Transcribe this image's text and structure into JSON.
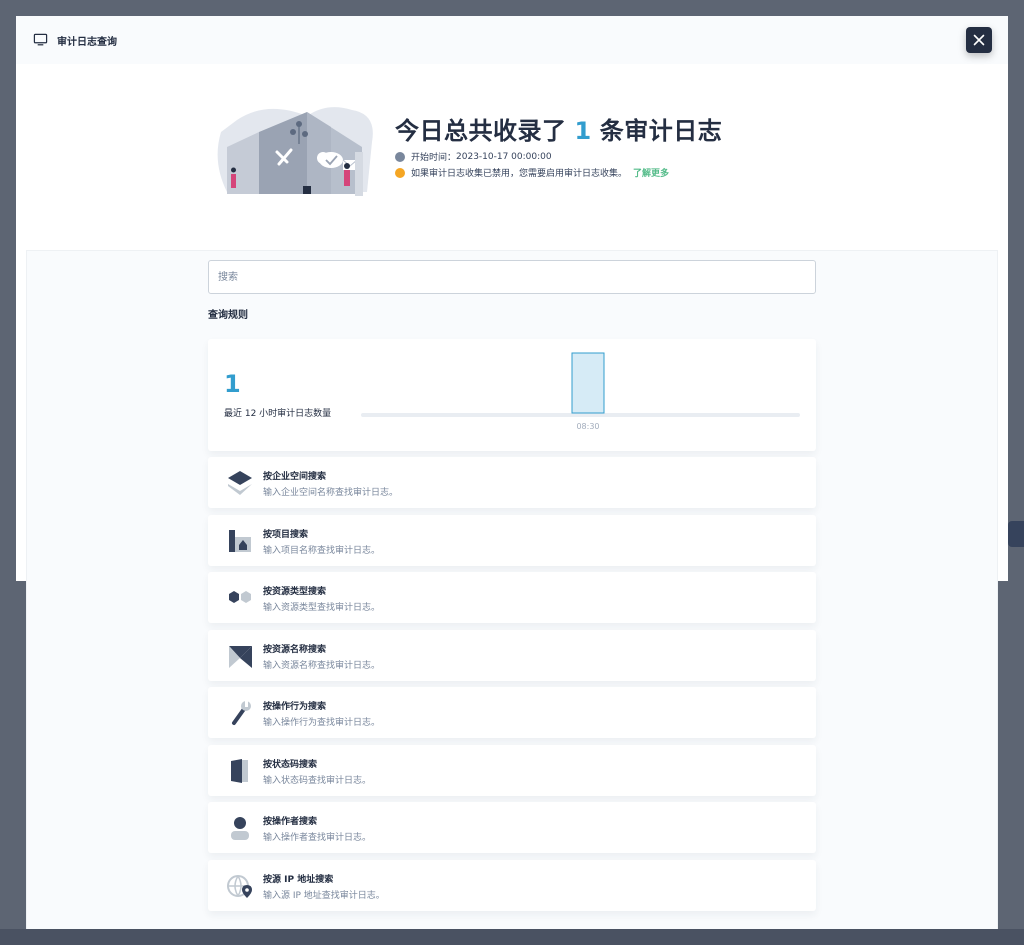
{
  "dialog": {
    "title": "审计日志查询",
    "close_icon": "close-icon"
  },
  "hero": {
    "title_prefix": "今日总共收录了",
    "count": "1",
    "title_suffix": "条审计日志",
    "start_time_label": "开始时间：",
    "start_time_value": "2023-10-17 00:00:00",
    "warning_text": "如果审计日志收集已禁用，您需要启用审计日志收集。",
    "learn_more": "了解更多"
  },
  "search": {
    "placeholder": "搜索"
  },
  "rules_title": "查询规则",
  "chart_card": {
    "count": "1",
    "label": "最近 12 小时审计日志数量"
  },
  "chart_data": {
    "type": "bar",
    "categories": [
      "08:30"
    ],
    "values": [
      1
    ],
    "title": "",
    "xlabel": "",
    "ylabel": "",
    "ylim": [
      0,
      1
    ],
    "bar_color": "#329dce"
  },
  "rules": [
    {
      "title": "按企业空间搜索",
      "desc": "输入企业空间名称查找审计日志。",
      "icon": "workspace-icon"
    },
    {
      "title": "按项目搜索",
      "desc": "输入项目名称查找审计日志。",
      "icon": "project-icon"
    },
    {
      "title": "按资源类型搜索",
      "desc": "输入资源类型查找审计日志。",
      "icon": "resource-type-icon"
    },
    {
      "title": "按资源名称搜索",
      "desc": "输入资源名称查找审计日志。",
      "icon": "resource-name-icon"
    },
    {
      "title": "按操作行为搜索",
      "desc": "输入操作行为查找审计日志。",
      "icon": "wrench-icon"
    },
    {
      "title": "按状态码搜索",
      "desc": "输入状态码查找审计日志。",
      "icon": "door-icon"
    },
    {
      "title": "按操作者搜索",
      "desc": "输入操作者查找审计日志。",
      "icon": "user-icon"
    },
    {
      "title": "按源 IP 地址搜索",
      "desc": "输入源 IP 地址查找审计日志。",
      "icon": "globe-location-icon"
    }
  ],
  "colors": {
    "accent": "#329dce",
    "link": "#55bc8a",
    "warning": "#f5a623",
    "dark": "#242e42"
  }
}
